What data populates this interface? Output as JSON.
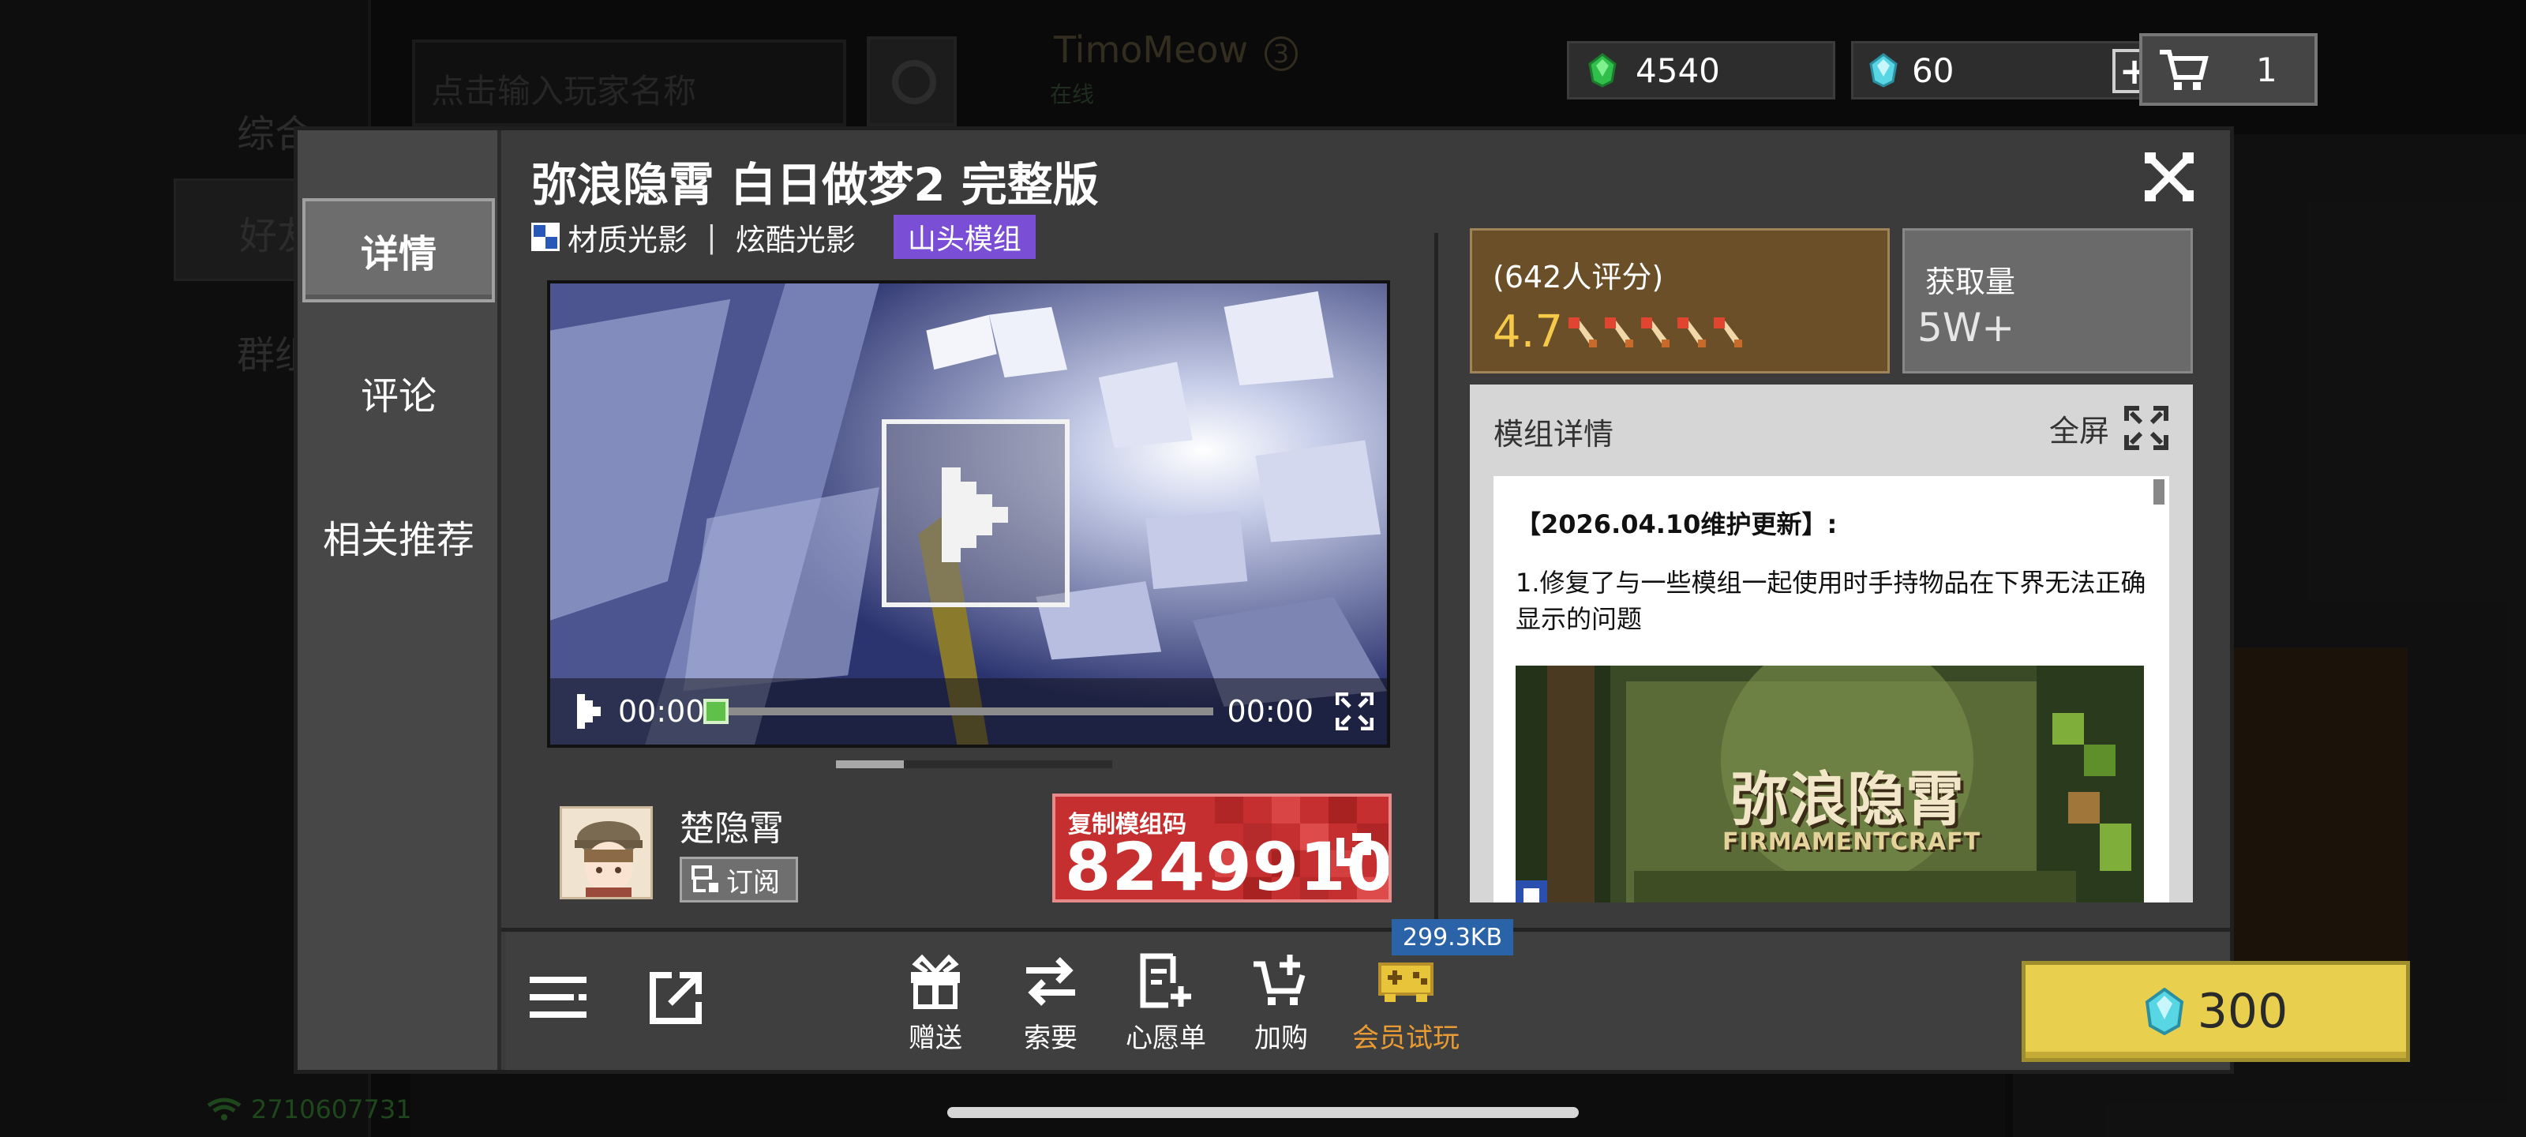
{
  "background": {
    "tabs": [
      "综合",
      "好友",
      "群组"
    ],
    "search_placeholder": "点击输入玩家名称",
    "friend_name": "TimoMeow",
    "friend_level": "3",
    "friend_status": "在线",
    "account_id": "2710607731"
  },
  "currency": {
    "emerald": "4540",
    "diamond": "60",
    "plus": "+",
    "cart_count": "1"
  },
  "dialog": {
    "title": "弥浪隐霄 白日做梦2 完整版",
    "tabs": [
      "详情",
      "评论",
      "相关推荐"
    ],
    "active_tab": 0,
    "tags": [
      "材质光影",
      "炫酷光影"
    ],
    "tag_separator": "|",
    "category_chip": "山头模组",
    "video": {
      "time_current": "00:00",
      "time_total": "00:00",
      "progress": 0
    },
    "author": {
      "name": "楚隐霄",
      "subscribe_label": "订阅"
    },
    "code_card": {
      "label": "复制模组码",
      "code": "8249910"
    },
    "rating": {
      "count_text": "(642人评分)",
      "score": "4.7",
      "stars": 4.7,
      "max_stars": 5
    },
    "downloads": {
      "label": "获取量",
      "value": "5W+"
    },
    "details": {
      "heading": "模组详情",
      "fullscreen_label": "全屏",
      "update_title": "【2026.04.10维护更新】:",
      "update_body": "1.修复了与一些模组一起使用时手持物品在下界无法正确显示的问题",
      "image_title": "弥浪隐霄",
      "image_subtitle": "FIRMAMENTCRAFT"
    },
    "bottom": {
      "actions": [
        "赠送",
        "索要",
        "心愿单",
        "加购",
        "会员试玩"
      ],
      "size_badge": "299.3KB",
      "price": "300"
    }
  },
  "colors": {
    "accent_yellow": "#e8cf4e",
    "chip_purple": "#7a4fd6",
    "code_red": "#c62f2f",
    "rating_brown": "#6b4f28",
    "vip_orange": "#e89b33"
  }
}
